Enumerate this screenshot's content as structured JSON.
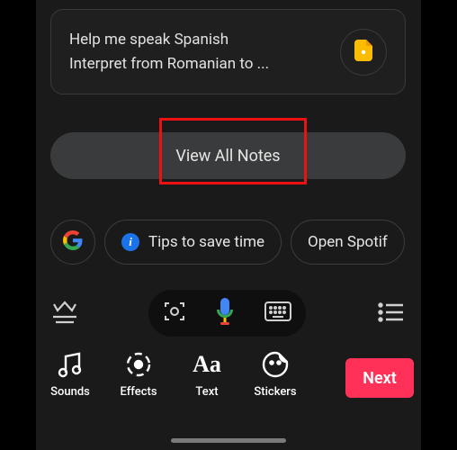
{
  "note": {
    "line1": "Help me speak Spanish",
    "line2": "Interpret from Romanian to ..."
  },
  "view_all_label": "View All Notes",
  "chips": {
    "tips": "Tips to save time",
    "spotify": "Open Spotif"
  },
  "actions": {
    "sounds": "Sounds",
    "effects": "Effects",
    "text": "Text",
    "stickers": "Stickers"
  },
  "next_label": "Next",
  "colors": {
    "accent": "#ff3158",
    "blue": "#1a73e8"
  }
}
